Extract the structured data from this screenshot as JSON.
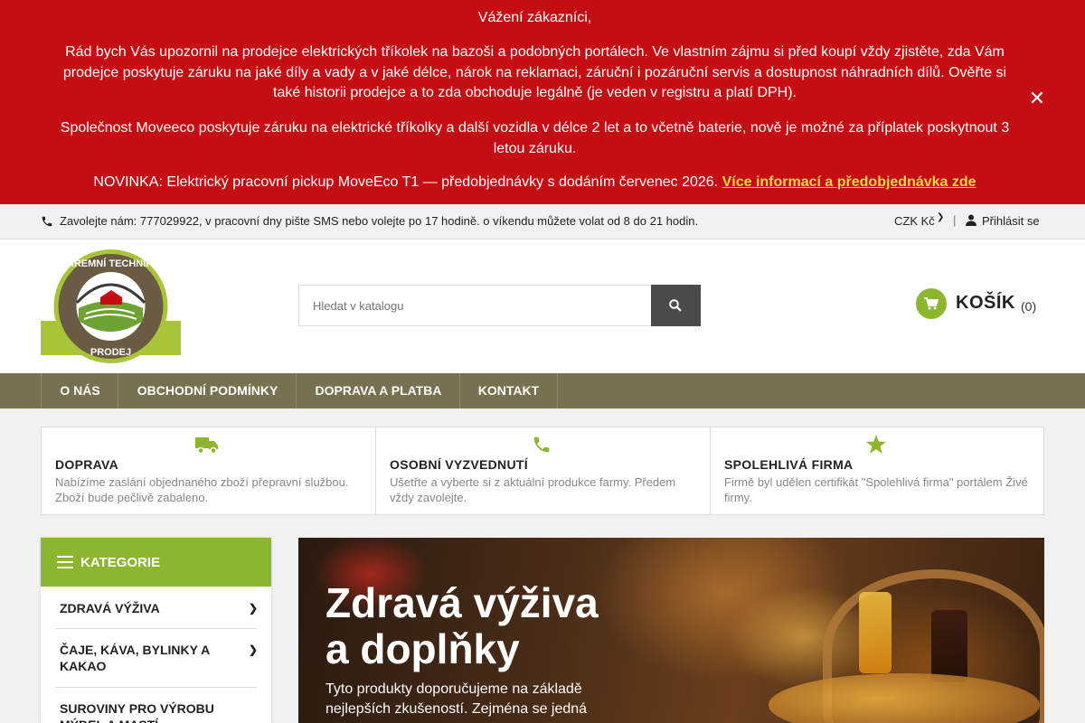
{
  "notice": {
    "greeting": "Vážení zákazníci,",
    "paragraph1": "Rád bych Vás upozornil na prodejce elektrických tříkolek na bazoši a podobných portálech. Ve vlastním zájmu si před koupí vždy zjistěte, zda Vám prodejce poskytuje záruku na jaké díly a vady a v jaké délce, nárok na reklamaci, záruční i pozáruční servis a dostupnost náhradních dílů. Ověřte si také historii prodejce a to zda obchoduje legálně (je veden v registru a platí DPH).",
    "paragraph2": "Společnost Moveeco poskytuje záruku na elektrické tříkolky a další vozidla v délce 2 let a to včetně baterie, nově je možné za příplatek poskytnout 3 letou záruku.",
    "novinka_text": "NOVINKA: Elektrický pracovní pickup MoveEco T1 — předobjednávky s dodáním červenec 2026. ",
    "novinka_link": "Více informací a předobjednávka zde",
    "close_symbol": "✕"
  },
  "topbar": {
    "phone_text": "Zavolejte nám: 777029922, v pracovní dny pište SMS nebo volejte po 17 hodině. o víkendu můžete volat od 8 do 21 hodin.",
    "currency": "CZK Kč",
    "separator": "|",
    "login": "Přihlásit se"
  },
  "header": {
    "logo_text_top": "FAREMNÍ TECHNIKA",
    "logo_text_bottom": "PRODEJ",
    "search_placeholder": "Hledat v katalogu",
    "cart_label": "KOŠÍK",
    "cart_count": "(0)"
  },
  "nav": {
    "items": [
      "O NÁS",
      "OBCHODNÍ PODMÍNKY",
      "DOPRAVA A PLATBA",
      "KONTAKT"
    ]
  },
  "features": [
    {
      "icon": "truck-icon",
      "title": "DOPRAVA",
      "text": "Nabízíme zaslání objednaného zboží přepravní službou. Zboží bude pečlivě zabaleno."
    },
    {
      "icon": "phone-icon",
      "title": "OSOBNÍ VYZVEDNUTÍ",
      "text": "Ušetřte a vyberte si z aktuální produkce farmy. Předem vždy zavolejte."
    },
    {
      "icon": "star-icon",
      "title": "SPOLEHLIVÁ FIRMA",
      "text": "Firmě byl udělen certifikát \"Spolehlivá firma\" portálem Živé firmy."
    }
  ],
  "sidebar": {
    "title": "KATEGORIE",
    "items": [
      "ZDRAVÁ VÝŽIVA",
      "ČAJE, KÁVA, BYLINKY A KAKAO",
      "SUROVINY PRO VÝROBU MÝDEL A MASTÍ"
    ]
  },
  "hero": {
    "title_line1": "Zdravá výživa",
    "title_line2": "a doplňky",
    "text": "Tyto produkty doporučujeme na základě nejlepších zkušeností. Zejména se jedná o"
  },
  "colors": {
    "notice_bg": "#c50d14",
    "link_yellow": "#f6d54a",
    "brand_green": "#8db62f",
    "nav_bg": "#76714f",
    "search_btn": "#4a4a48"
  }
}
